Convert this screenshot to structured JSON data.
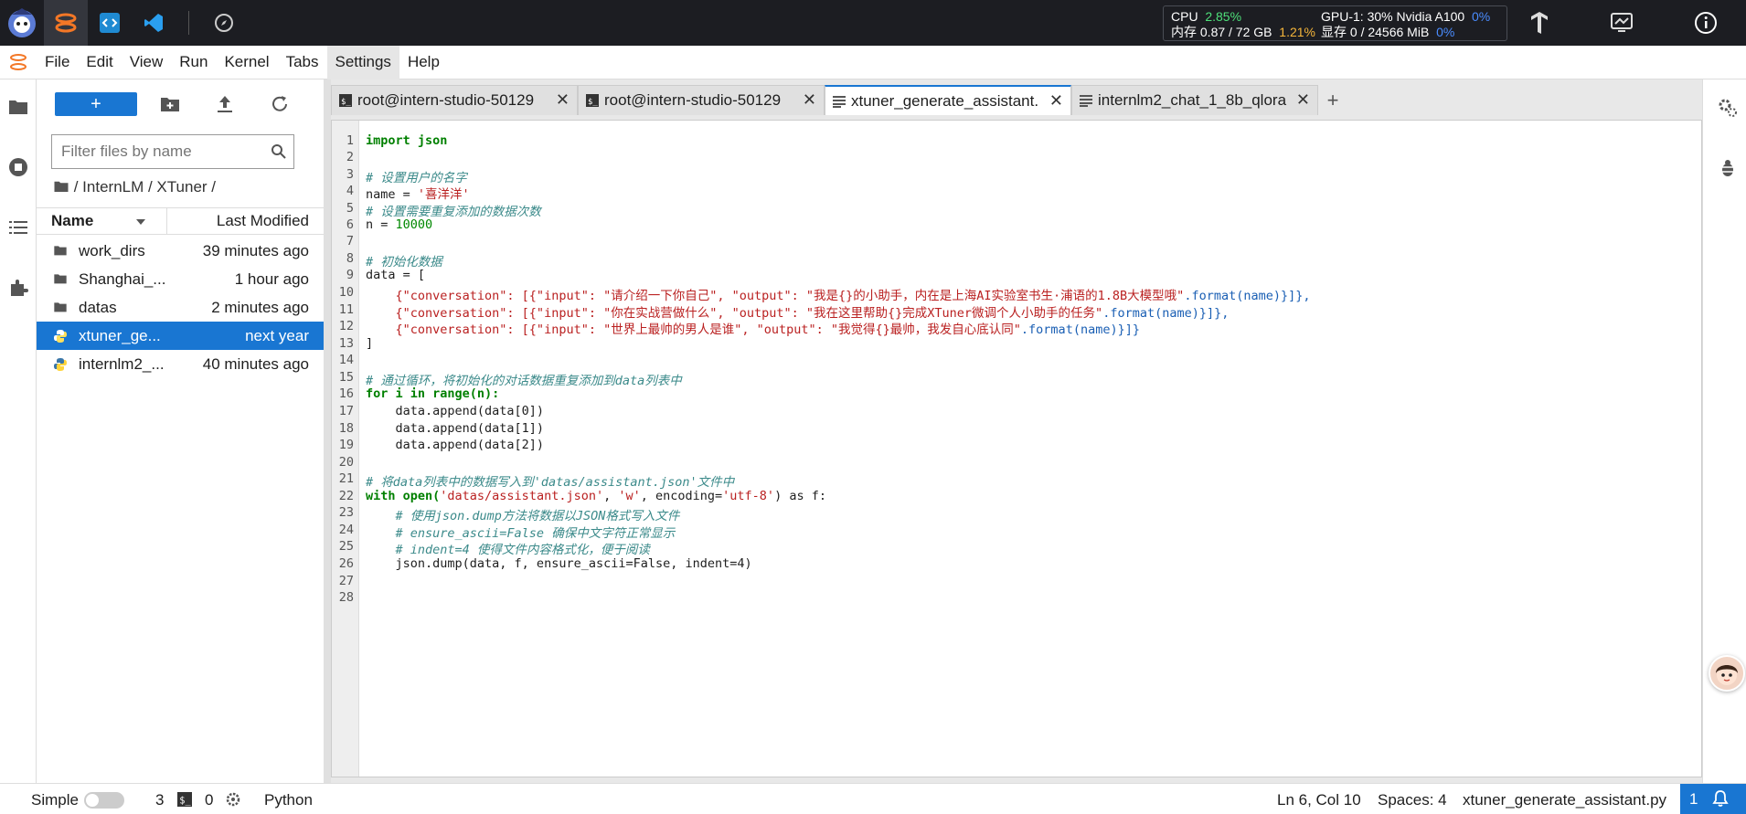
{
  "resources": {
    "cpu_label": "CPU",
    "cpu_value": "2.85%",
    "mem_label": "内存",
    "mem_value": "0.87 / 72 GB",
    "mem_pct": "1.21%",
    "gpu_label": "GPU-1: 30% Nvidia A100",
    "gpu_pct": "0%",
    "vram_label": "显存",
    "vram_value": "0 / 24566 MiB",
    "vram_pct": "0%"
  },
  "menu": [
    "File",
    "Edit",
    "View",
    "Run",
    "Kernel",
    "Tabs",
    "Settings",
    "Help"
  ],
  "filebrowser": {
    "new_label": "+",
    "filter_placeholder": "Filter files by name",
    "breadcrumb": "/ InternLM / XTuner /",
    "col_name": "Name",
    "col_modified": "Last Modified",
    "files": [
      {
        "name": "work_dirs",
        "modified": "39 minutes ago",
        "type": "folder"
      },
      {
        "name": "Shanghai_...",
        "modified": "1 hour ago",
        "type": "folder"
      },
      {
        "name": "datas",
        "modified": "2 minutes ago",
        "type": "folder"
      },
      {
        "name": "xtuner_ge...",
        "modified": "next year",
        "type": "python"
      },
      {
        "name": "internlm2_...",
        "modified": "40 minutes ago",
        "type": "python"
      }
    ]
  },
  "tabs": [
    {
      "label": "root@intern-studio-50129",
      "type": "terminal"
    },
    {
      "label": "root@intern-studio-50129",
      "type": "terminal"
    },
    {
      "label": "xtuner_generate_assistant.",
      "type": "file",
      "active": true
    },
    {
      "label": "internlm2_chat_1_8b_qlora",
      "type": "file"
    }
  ],
  "tab_close": "✕",
  "add_tab": "+",
  "code": {
    "l1": "import json",
    "l3": "# 设置用户的名字",
    "l4a": "name = ",
    "l4b": "'喜洋洋'",
    "l5": "# 设置需要重复添加的数据次数",
    "l6a": "n = ",
    "l6b": "10000",
    "l8": "# 初始化数据",
    "l9": "data = [",
    "l10a": "    {\"conversation\": [{\"input\": ",
    "l10b": "\"请介绍一下你自己\"",
    "l10c": ", \"output\": ",
    "l10d": "\"我是{}的小助手，内在是上海AI实验室书生·浦语的1.8B大模型哦\"",
    "l10e": ".format(name)}]},",
    "l11a": "    {\"conversation\": [{\"input\": ",
    "l11b": "\"你在实战营做什么\"",
    "l11c": ", \"output\": ",
    "l11d": "\"我在这里帮助{}完成XTuner微调个人小助手的任务\"",
    "l11e": ".format(name)}]},",
    "l12a": "    {\"conversation\": [{\"input\": ",
    "l12b": "\"世界上最帅的男人是谁\"",
    "l12c": ", \"output\": ",
    "l12d": "\"我觉得{}最帅，我发自心底认同\"",
    "l12e": ".format(name)}]}",
    "l13": "]",
    "l15": "# 通过循环，将初始化的对话数据重复添加到data列表中",
    "l16": "for i in range(n):",
    "l17": "    data.append(data[0])",
    "l18": "    data.append(data[1])",
    "l19": "    data.append(data[2])",
    "l21": "# 将data列表中的数据写入到'datas/assistant.json'文件中",
    "l22a": "with ",
    "l22b": "open(",
    "l22c": "'datas/assistant.json'",
    "l22d": ", ",
    "l22e": "'w'",
    "l22f": ", encoding=",
    "l22g": "'utf-8'",
    "l22h": ") as f:",
    "l23": "    # 使用json.dump方法将数据以JSON格式写入文件",
    "l24": "    # ensure_ascii=False 确保中文字符正常显示",
    "l25": "    # indent=4 使得文件内容格式化，便于阅读",
    "l26": "    json.dump(data, f, ensure_ascii=False, indent=4)"
  },
  "status": {
    "mode": "Simple",
    "kernels": "3",
    "terminals": "0",
    "language": "Python",
    "cursor": "Ln 6, Col 10",
    "spaces": "Spaces: 4",
    "filename": "xtuner_generate_assistant.py",
    "notifications": "1"
  }
}
